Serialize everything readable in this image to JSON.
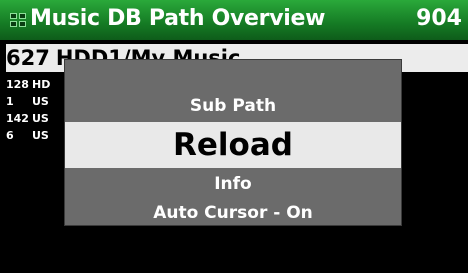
{
  "header": {
    "title": "Music DB Path Overview",
    "count": "904"
  },
  "selected": {
    "count": "627",
    "path": "HDD1/My Music"
  },
  "rows": [
    {
      "count": "128",
      "path": "HD"
    },
    {
      "count": "1",
      "path": "US"
    },
    {
      "count": "142",
      "path": "US"
    },
    {
      "count": "6",
      "path": "US"
    }
  ],
  "menu": {
    "items": [
      {
        "label": "Sub Path"
      },
      {
        "label": "Reload"
      },
      {
        "label": "Info"
      },
      {
        "label": "Auto Cursor - On"
      }
    ],
    "selected_index": 1
  },
  "colors": {
    "title_bar": "#1e9430",
    "selected_row": "#ececec",
    "popup_bg": "#6b6b6b",
    "popup_highlight": "#e9e9e9"
  }
}
